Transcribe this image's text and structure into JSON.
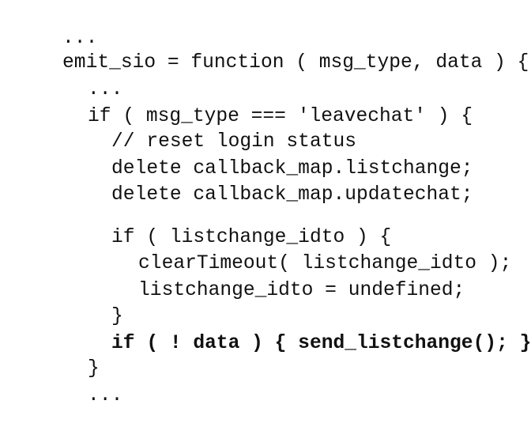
{
  "code": {
    "lines": [
      "...",
      "emit_sio = function ( msg_type, data ) {",
      "...",
      "if ( msg_type === 'leavechat' ) {",
      "// reset login status",
      "delete callback_map.listchange;",
      "delete callback_map.updatechat;",
      "",
      "if ( listchange_idto ) {",
      "clearTimeout( listchange_idto );",
      "listchange_idto = undefined;",
      "}",
      "if ( ! data ) { send_listchange(); }",
      "}",
      "..."
    ]
  }
}
